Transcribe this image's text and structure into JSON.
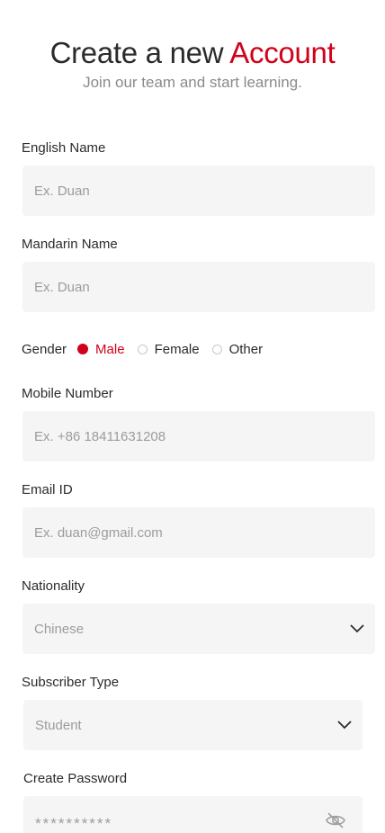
{
  "header": {
    "title_prefix": "Create a new ",
    "title_accent": "Account",
    "subtitle": "Join our team and start learning."
  },
  "form": {
    "english_name": {
      "label": "English Name",
      "placeholder": "Ex. Duan"
    },
    "mandarin_name": {
      "label": "Mandarin Name",
      "placeholder": "Ex. Duan"
    },
    "gender": {
      "label": "Gender",
      "options": [
        "Male",
        "Female",
        "Other"
      ],
      "selected": "Male"
    },
    "mobile": {
      "label": "Mobile Number",
      "placeholder": "Ex. +86 18411631208"
    },
    "email": {
      "label": "Email ID",
      "placeholder": "Ex. duan@gmail.com"
    },
    "nationality": {
      "label": "Nationality",
      "value": "Chinese"
    },
    "subscriber_type": {
      "label": "Subscriber Type",
      "value": "Student"
    },
    "password": {
      "label": "Create Password",
      "value": "**********"
    }
  },
  "colors": {
    "accent": "#d0021b",
    "field_bg": "#f5f5f5",
    "muted": "#9c9c9c"
  },
  "icons": {
    "select": "chevron-down-icon",
    "password_toggle": "eye-off-icon"
  }
}
